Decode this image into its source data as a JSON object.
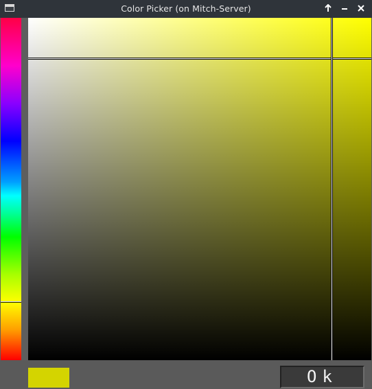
{
  "window": {
    "title": "Color Picker (on Mitch-Server)",
    "app_icon": "window-icon",
    "controls": [
      {
        "name": "keep-above-button",
        "icon": "arrow-up-icon"
      },
      {
        "name": "minimize-button",
        "icon": "minimize-icon"
      },
      {
        "name": "close-button",
        "icon": "close-icon"
      }
    ]
  },
  "picker": {
    "hue_level": 0.173,
    "saturation": 0.883,
    "value": 0.882,
    "current_hue_color": "#ffff00",
    "selected_color": "#d4d400"
  },
  "ok_button": {
    "label": "Ok"
  }
}
